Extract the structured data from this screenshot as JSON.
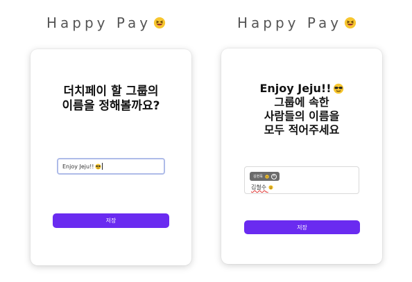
{
  "brand": {
    "text": "Happy Pay",
    "emoji_icon": "grinning-squinting-face-icon"
  },
  "screen_left": {
    "title_line1": "더치페이 할 그룹의",
    "title_line2": "이름을 정해볼까요?",
    "group_input_value": "Enjoy Jeju!!",
    "save_label": "저장"
  },
  "screen_right": {
    "title_group_name": "Enjoy Jeju!!",
    "title_line2": "그룹에 속한",
    "title_line3": "사람들의 이름을",
    "title_line4": "모두 적어주세요",
    "member_chip_label": "김현욱",
    "name_input_value": "김철수",
    "save_label": "저장"
  },
  "colors": {
    "accent": "#6a2bf0",
    "input_focus_border": "#aebbe8",
    "chip_bg": "#6b6b6b"
  }
}
